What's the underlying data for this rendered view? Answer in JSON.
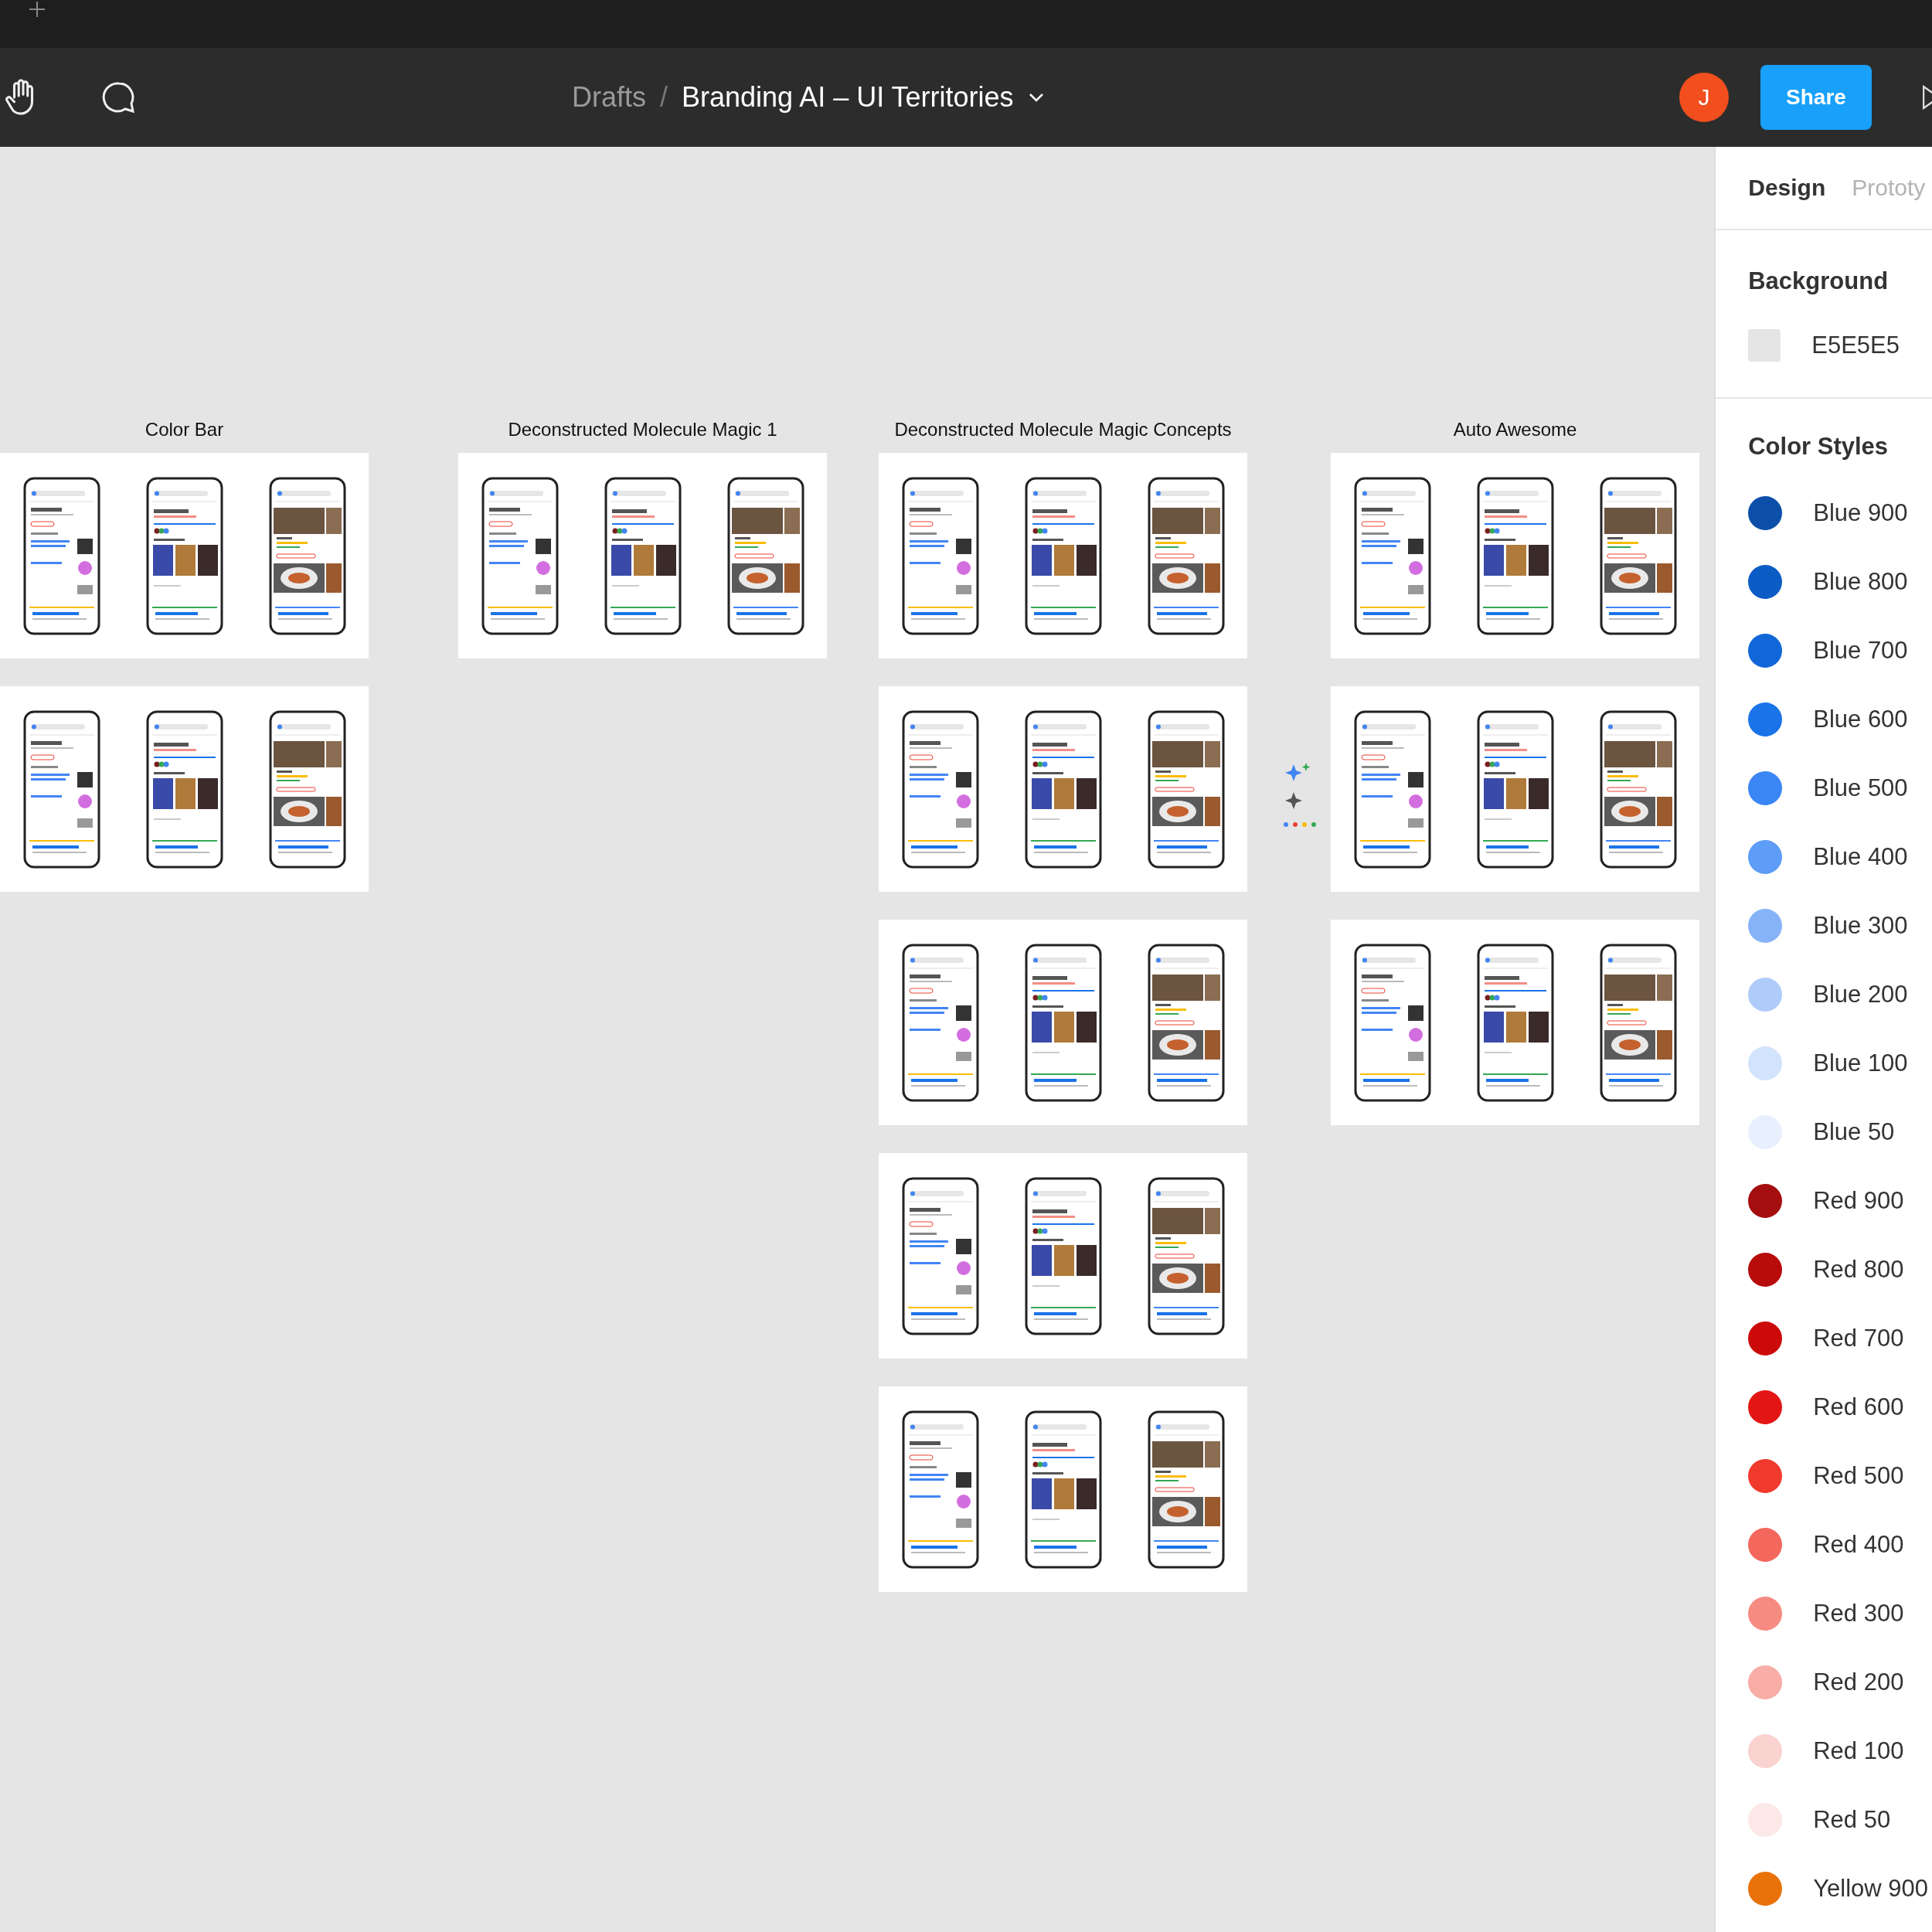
{
  "toolbar": {
    "breadcrumb_parent": "Drafts",
    "separator": "/",
    "file_title": "Branding AI – UI Territories",
    "avatar_initial": "J",
    "share_label": "Share"
  },
  "canvas": {
    "columns": [
      {
        "title": "Color Bar",
        "frames": [
          {
            "phones": [
              {
                "kind": "search"
              },
              {
                "kind": "watch"
              },
              {
                "kind": "restaurant"
              }
            ]
          },
          {
            "phones": [
              {
                "kind": "search"
              },
              {
                "kind": "watch"
              },
              {
                "kind": "restaurant"
              }
            ]
          }
        ]
      },
      {
        "title": "Deconstructed Molecule Magic 1",
        "frames": [
          {
            "phones": [
              {
                "kind": "search"
              },
              {
                "kind": "watch"
              },
              {
                "kind": "restaurant"
              }
            ]
          }
        ]
      },
      {
        "title": "Deconstructed Molecule Magic Concepts",
        "frames": [
          {
            "phones": [
              {
                "kind": "search"
              },
              {
                "kind": "watch"
              },
              {
                "kind": "restaurant"
              }
            ]
          },
          {
            "phones": [
              {
                "kind": "search"
              },
              {
                "kind": "watch"
              },
              {
                "kind": "restaurant"
              }
            ]
          },
          {
            "phones": [
              {
                "kind": "search"
              },
              {
                "kind": "watch"
              },
              {
                "kind": "restaurant"
              }
            ]
          },
          {
            "phones": [
              {
                "kind": "search"
              },
              {
                "kind": "watch"
              },
              {
                "kind": "restaurant"
              }
            ]
          },
          {
            "phones": [
              {
                "kind": "search"
              },
              {
                "kind": "watch"
              },
              {
                "kind": "restaurant"
              }
            ]
          }
        ]
      },
      {
        "title": "Auto Awesome",
        "frames": [
          {
            "phones": [
              {
                "kind": "search"
              },
              {
                "kind": "watch"
              },
              {
                "kind": "restaurant"
              }
            ]
          },
          {
            "phones": [
              {
                "kind": "search"
              },
              {
                "kind": "watch"
              },
              {
                "kind": "restaurant"
              }
            ]
          },
          {
            "phones": [
              {
                "kind": "search"
              },
              {
                "kind": "watch"
              },
              {
                "kind": "restaurant"
              }
            ]
          }
        ]
      }
    ]
  },
  "panel": {
    "tabs": [
      {
        "label": "Design",
        "selected": true
      },
      {
        "label": "Prototy",
        "selected": false
      }
    ],
    "background_heading": "Background",
    "background_value": "E5E5E5",
    "color_styles_heading": "Color Styles",
    "color_styles": [
      {
        "name": "Blue 900",
        "color": "#0b4fa8"
      },
      {
        "name": "Blue 800",
        "color": "#0b5cc4"
      },
      {
        "name": "Blue 700",
        "color": "#1167d8"
      },
      {
        "name": "Blue 600",
        "color": "#1a73e8"
      },
      {
        "name": "Blue 500",
        "color": "#3b86f5"
      },
      {
        "name": "Blue 400",
        "color": "#5d9cf7"
      },
      {
        "name": "Blue 300",
        "color": "#86b3f8"
      },
      {
        "name": "Blue 200",
        "color": "#aecbfa"
      },
      {
        "name": "Blue 100",
        "color": "#d2e3fc"
      },
      {
        "name": "Blue 50",
        "color": "#e8f0fe"
      },
      {
        "name": "Red 900",
        "color": "#a50e0e"
      },
      {
        "name": "Red 800",
        "color": "#b80b0b"
      },
      {
        "name": "Red 700",
        "color": "#cc0a0a"
      },
      {
        "name": "Red 600",
        "color": "#e41515"
      },
      {
        "name": "Red 500",
        "color": "#f03a2e"
      },
      {
        "name": "Red 400",
        "color": "#f4675c"
      },
      {
        "name": "Red 300",
        "color": "#f68b82"
      },
      {
        "name": "Red 200",
        "color": "#f8ada7"
      },
      {
        "name": "Red 100",
        "color": "#fad2cf"
      },
      {
        "name": "Red 50",
        "color": "#fce8e6"
      },
      {
        "name": "Yellow 900",
        "color": "#e8710a"
      }
    ]
  }
}
